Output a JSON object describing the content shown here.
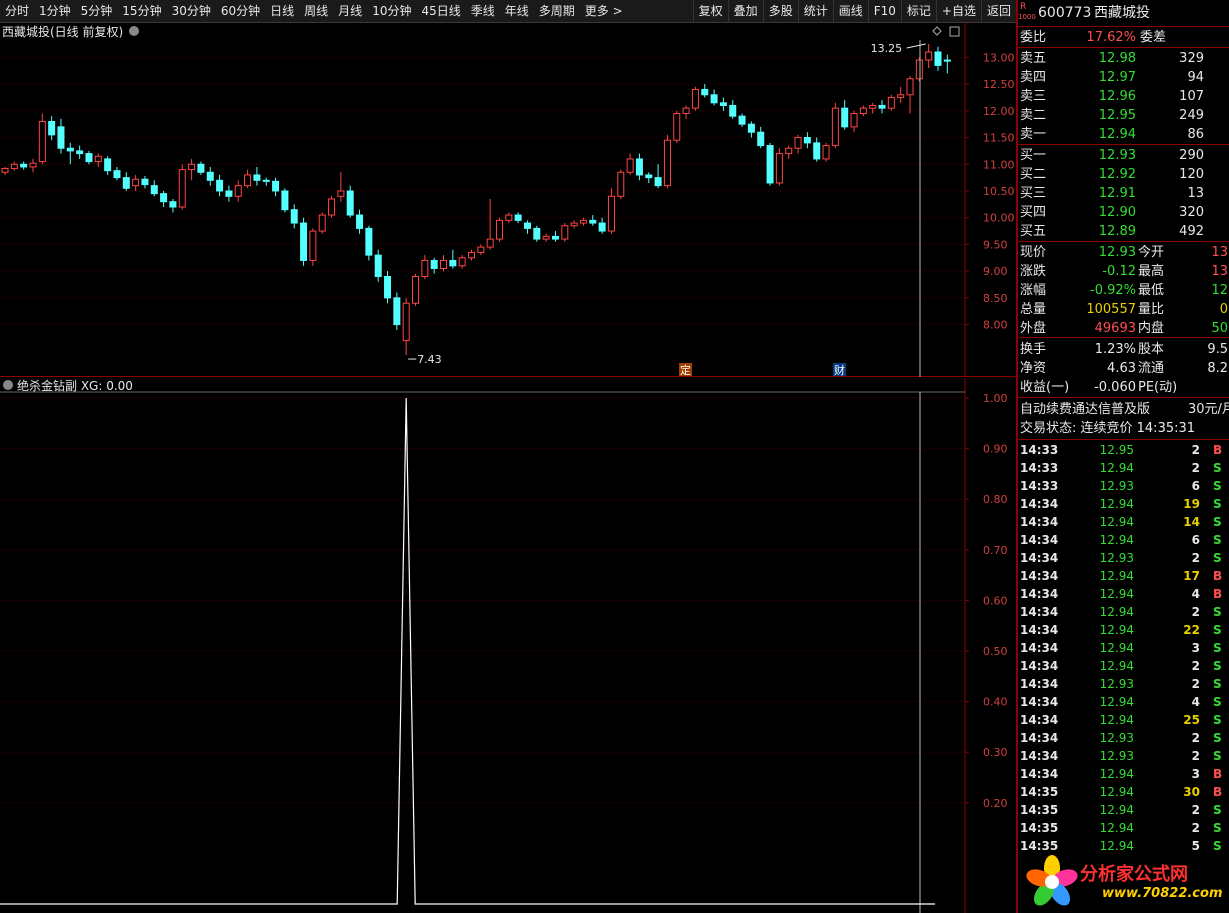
{
  "toolbar": {
    "periods": [
      "分时",
      "1分钟",
      "5分钟",
      "15分钟",
      "30分钟",
      "60分钟",
      "日线",
      "周线",
      "月线",
      "10分钟",
      "45日线",
      "季线",
      "年线",
      "多周期",
      "更多 >"
    ],
    "actions": [
      "复权",
      "叠加",
      "多股",
      "统计",
      "画线",
      "F10",
      "标记",
      "+自选",
      "返回"
    ]
  },
  "chart": {
    "header": "西藏城投(日线 前复权)",
    "high_label": "13.25",
    "low_label": "7.43",
    "badge_ding": "定",
    "badge_cai": "财",
    "y_ticks": [
      "13.00",
      "12.50",
      "12.00",
      "11.50",
      "11.00",
      "10.50",
      "10.00",
      "9.50",
      "9.00",
      "8.50",
      "8.00"
    ]
  },
  "indicator": {
    "header": "绝杀金钻副 XG: 0.00",
    "y_ticks": [
      "1.00",
      "0.90",
      "0.80",
      "0.70",
      "0.60",
      "0.50",
      "0.40",
      "0.30",
      "0.20"
    ]
  },
  "chart_data": {
    "type": "candlestick",
    "ylim": [
      7.3,
      13.4
    ],
    "candles": [
      [
        10.85,
        10.95,
        10.8,
        10.92
      ],
      [
        10.92,
        11.05,
        10.88,
        11.0
      ],
      [
        11.0,
        11.05,
        10.9,
        10.95
      ],
      [
        10.95,
        11.1,
        10.85,
        11.02
      ],
      [
        11.05,
        11.95,
        11.0,
        11.8
      ],
      [
        11.8,
        11.9,
        11.45,
        11.55
      ],
      [
        11.7,
        11.85,
        11.2,
        11.3
      ],
      [
        11.3,
        11.4,
        11.0,
        11.25
      ],
      [
        11.25,
        11.35,
        11.1,
        11.2
      ],
      [
        11.2,
        11.25,
        11.0,
        11.05
      ],
      [
        11.05,
        11.2,
        10.95,
        11.15
      ],
      [
        11.1,
        11.15,
        10.8,
        10.88
      ],
      [
        10.88,
        10.95,
        10.7,
        10.75
      ],
      [
        10.75,
        10.85,
        10.5,
        10.55
      ],
      [
        10.6,
        10.8,
        10.5,
        10.72
      ],
      [
        10.72,
        10.78,
        10.55,
        10.62
      ],
      [
        10.6,
        10.7,
        10.4,
        10.45
      ],
      [
        10.45,
        10.5,
        10.2,
        10.3
      ],
      [
        10.3,
        10.35,
        10.1,
        10.2
      ],
      [
        10.2,
        11.0,
        10.15,
        10.9
      ],
      [
        10.9,
        11.1,
        10.7,
        11.0
      ],
      [
        11.0,
        11.05,
        10.8,
        10.85
      ],
      [
        10.85,
        10.95,
        10.6,
        10.7
      ],
      [
        10.7,
        10.8,
        10.4,
        10.5
      ],
      [
        10.5,
        10.6,
        10.3,
        10.4
      ],
      [
        10.4,
        10.7,
        10.3,
        10.6
      ],
      [
        10.6,
        10.9,
        10.55,
        10.8
      ],
      [
        10.8,
        10.95,
        10.6,
        10.7
      ],
      [
        10.7,
        10.75,
        10.6,
        10.68
      ],
      [
        10.68,
        10.75,
        10.4,
        10.5
      ],
      [
        10.5,
        10.55,
        10.1,
        10.15
      ],
      [
        10.15,
        10.25,
        9.8,
        9.9
      ],
      [
        9.9,
        10.0,
        9.1,
        9.2
      ],
      [
        9.2,
        9.8,
        9.1,
        9.75
      ],
      [
        9.75,
        10.1,
        9.7,
        10.05
      ],
      [
        10.05,
        10.4,
        10.0,
        10.35
      ],
      [
        10.4,
        10.85,
        10.3,
        10.5
      ],
      [
        10.5,
        10.6,
        10.0,
        10.05
      ],
      [
        10.05,
        10.15,
        9.7,
        9.8
      ],
      [
        9.8,
        9.85,
        9.2,
        9.3
      ],
      [
        9.3,
        9.4,
        8.8,
        8.9
      ],
      [
        8.9,
        9.0,
        8.4,
        8.5
      ],
      [
        8.5,
        8.6,
        7.9,
        8.0
      ],
      [
        7.7,
        8.5,
        7.43,
        8.4
      ],
      [
        8.4,
        8.95,
        8.35,
        8.9
      ],
      [
        8.9,
        9.3,
        8.85,
        9.2
      ],
      [
        9.2,
        9.25,
        8.95,
        9.05
      ],
      [
        9.05,
        9.3,
        9.0,
        9.2
      ],
      [
        9.2,
        9.4,
        9.05,
        9.1
      ],
      [
        9.1,
        9.3,
        9.05,
        9.25
      ],
      [
        9.25,
        9.4,
        9.2,
        9.35
      ],
      [
        9.35,
        9.5,
        9.3,
        9.45
      ],
      [
        9.45,
        10.35,
        9.4,
        9.6
      ],
      [
        9.6,
        10.0,
        9.55,
        9.95
      ],
      [
        9.95,
        10.1,
        9.9,
        10.05
      ],
      [
        10.05,
        10.1,
        9.9,
        9.95
      ],
      [
        9.9,
        9.95,
        9.7,
        9.8
      ],
      [
        9.8,
        9.85,
        9.55,
        9.6
      ],
      [
        9.6,
        9.7,
        9.55,
        9.65
      ],
      [
        9.65,
        9.75,
        9.55,
        9.6
      ],
      [
        9.6,
        9.9,
        9.55,
        9.85
      ],
      [
        9.85,
        9.95,
        9.8,
        9.9
      ],
      [
        9.9,
        10.0,
        9.85,
        9.95
      ],
      [
        9.95,
        10.05,
        9.85,
        9.9
      ],
      [
        9.9,
        10.0,
        9.7,
        9.75
      ],
      [
        9.75,
        10.55,
        9.7,
        10.4
      ],
      [
        10.4,
        10.9,
        10.35,
        10.85
      ],
      [
        10.85,
        11.2,
        10.8,
        11.1
      ],
      [
        11.1,
        11.2,
        10.7,
        10.8
      ],
      [
        10.8,
        10.85,
        10.65,
        10.75
      ],
      [
        10.75,
        11.0,
        10.55,
        10.6
      ],
      [
        10.6,
        11.55,
        10.55,
        11.45
      ],
      [
        11.45,
        12.0,
        11.4,
        11.95
      ],
      [
        11.95,
        12.1,
        11.85,
        12.05
      ],
      [
        12.05,
        12.45,
        12.0,
        12.4
      ],
      [
        12.4,
        12.5,
        12.25,
        12.3
      ],
      [
        12.3,
        12.4,
        12.1,
        12.15
      ],
      [
        12.15,
        12.25,
        12.0,
        12.1
      ],
      [
        12.1,
        12.2,
        11.85,
        11.9
      ],
      [
        11.9,
        11.95,
        11.7,
        11.75
      ],
      [
        11.75,
        11.8,
        11.5,
        11.6
      ],
      [
        11.6,
        11.7,
        11.3,
        11.35
      ],
      [
        11.35,
        11.4,
        10.6,
        10.65
      ],
      [
        10.65,
        11.3,
        10.6,
        11.2
      ],
      [
        11.2,
        11.35,
        11.1,
        11.3
      ],
      [
        11.3,
        11.55,
        11.2,
        11.5
      ],
      [
        11.5,
        11.6,
        11.3,
        11.4
      ],
      [
        11.4,
        11.5,
        11.05,
        11.1
      ],
      [
        11.1,
        11.4,
        11.05,
        11.35
      ],
      [
        11.35,
        12.15,
        11.3,
        12.05
      ],
      [
        12.05,
        12.2,
        11.65,
        11.7
      ],
      [
        11.7,
        12.0,
        11.6,
        11.95
      ],
      [
        11.95,
        12.1,
        11.9,
        12.05
      ],
      [
        12.05,
        12.15,
        11.95,
        12.1
      ],
      [
        12.1,
        12.2,
        11.95,
        12.05
      ],
      [
        12.05,
        12.3,
        12.0,
        12.25
      ],
      [
        12.25,
        12.45,
        12.15,
        12.3
      ],
      [
        12.3,
        12.65,
        11.95,
        12.6
      ],
      [
        12.6,
        13.0,
        12.55,
        12.95
      ],
      [
        12.95,
        13.25,
        12.8,
        13.1
      ],
      [
        13.1,
        13.2,
        12.75,
        12.85
      ],
      [
        12.95,
        13.05,
        12.7,
        12.93
      ]
    ],
    "indicator_spike_index": 43
  },
  "panel": {
    "code": "600773",
    "name": "西藏城投",
    "r_label": "R",
    "r_sub": "1000",
    "weibi_label": "委比",
    "weibi_value": "17.62%",
    "weicha_label": "委差",
    "asks": [
      {
        "label": "卖五",
        "price": "12.98",
        "vol": "329"
      },
      {
        "label": "卖四",
        "price": "12.97",
        "vol": "94"
      },
      {
        "label": "卖三",
        "price": "12.96",
        "vol": "107"
      },
      {
        "label": "卖二",
        "price": "12.95",
        "vol": "249"
      },
      {
        "label": "卖一",
        "price": "12.94",
        "vol": "86"
      }
    ],
    "bids": [
      {
        "label": "买一",
        "price": "12.93",
        "vol": "290"
      },
      {
        "label": "买二",
        "price": "12.92",
        "vol": "120"
      },
      {
        "label": "买三",
        "price": "12.91",
        "vol": "13"
      },
      {
        "label": "买四",
        "price": "12.90",
        "vol": "320"
      },
      {
        "label": "买五",
        "price": "12.89",
        "vol": "492"
      }
    ],
    "quote": [
      {
        "l": "现价",
        "v": "12.93",
        "vc": "green",
        "l2": "今开",
        "v2": "13",
        "v2c": "red"
      },
      {
        "l": "涨跌",
        "v": "-0.12",
        "vc": "green",
        "l2": "最高",
        "v2": "13",
        "v2c": "red"
      },
      {
        "l": "涨幅",
        "v": "-0.92%",
        "vc": "green",
        "l2": "最低",
        "v2": "12",
        "v2c": "green"
      },
      {
        "l": "总量",
        "v": "100557",
        "vc": "yellow",
        "l2": "量比",
        "v2": "0",
        "v2c": "yellow"
      },
      {
        "l": "外盘",
        "v": "49693",
        "vc": "red",
        "l2": "内盘",
        "v2": "50",
        "v2c": "green"
      }
    ],
    "stats": [
      {
        "l": "换手",
        "v": "1.23%",
        "l2": "股本",
        "v2": "9.5"
      },
      {
        "l": "净资",
        "v": "4.63",
        "l2": "流通",
        "v2": "8.2"
      },
      {
        "l": "收益(一)",
        "v": "-0.060",
        "l2": "PE(动)",
        "v2": ""
      }
    ],
    "promo": "自动续费通达信普及版",
    "promo_price": "30元/月",
    "status": "交易状态: 连续竞价 14:35:31",
    "ticks": [
      {
        "t": "14:33",
        "p": "12.95",
        "v": "2",
        "s": "B"
      },
      {
        "t": "14:33",
        "p": "12.94",
        "v": "2",
        "s": "S"
      },
      {
        "t": "14:33",
        "p": "12.93",
        "v": "6",
        "s": "S"
      },
      {
        "t": "14:34",
        "p": "12.94",
        "v": "19",
        "s": "S"
      },
      {
        "t": "14:34",
        "p": "12.94",
        "v": "14",
        "s": "S"
      },
      {
        "t": "14:34",
        "p": "12.94",
        "v": "6",
        "s": "S"
      },
      {
        "t": "14:34",
        "p": "12.93",
        "v": "2",
        "s": "S"
      },
      {
        "t": "14:34",
        "p": "12.94",
        "v": "17",
        "s": "B"
      },
      {
        "t": "14:34",
        "p": "12.94",
        "v": "4",
        "s": "B"
      },
      {
        "t": "14:34",
        "p": "12.94",
        "v": "2",
        "s": "S"
      },
      {
        "t": "14:34",
        "p": "12.94",
        "v": "22",
        "s": "S"
      },
      {
        "t": "14:34",
        "p": "12.94",
        "v": "3",
        "s": "S"
      },
      {
        "t": "14:34",
        "p": "12.94",
        "v": "2",
        "s": "S"
      },
      {
        "t": "14:34",
        "p": "12.93",
        "v": "2",
        "s": "S"
      },
      {
        "t": "14:34",
        "p": "12.94",
        "v": "4",
        "s": "S"
      },
      {
        "t": "14:34",
        "p": "12.94",
        "v": "25",
        "s": "S"
      },
      {
        "t": "14:34",
        "p": "12.93",
        "v": "2",
        "s": "S"
      },
      {
        "t": "14:34",
        "p": "12.93",
        "v": "2",
        "s": "S"
      },
      {
        "t": "14:34",
        "p": "12.94",
        "v": "3",
        "s": "B"
      },
      {
        "t": "14:35",
        "p": "12.94",
        "v": "30",
        "s": "B"
      },
      {
        "t": "14:35",
        "p": "12.94",
        "v": "2",
        "s": "S"
      },
      {
        "t": "14:35",
        "p": "12.94",
        "v": "2",
        "s": "S"
      },
      {
        "t": "14:35",
        "p": "12.94",
        "v": "5",
        "s": "S"
      }
    ],
    "watermark": "分析家公式网",
    "watermark_url": "www.70822.com"
  },
  "colors": {
    "up": "#ff4444",
    "down": "#54ffff",
    "grid": "#8b0000",
    "panel_border": "#8b0000"
  }
}
